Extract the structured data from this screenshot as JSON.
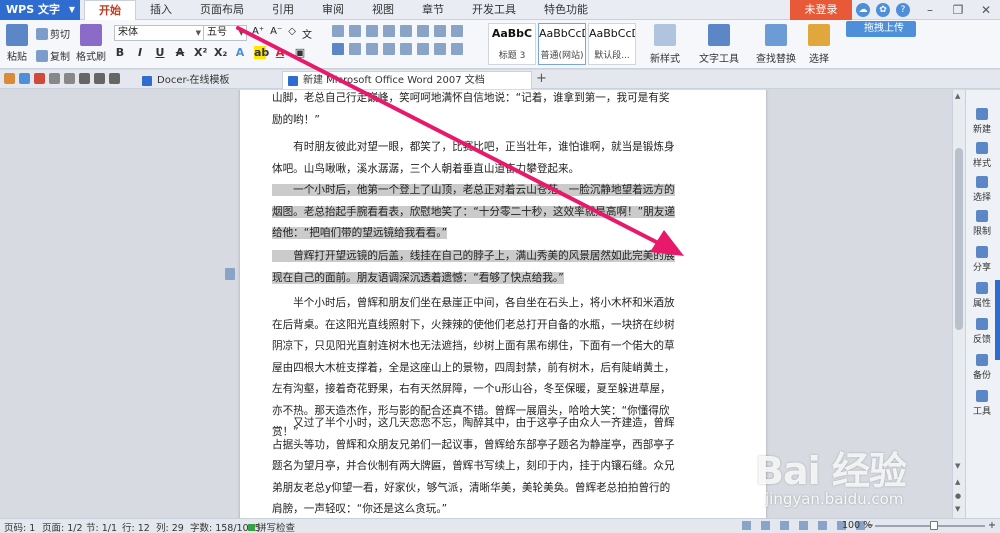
{
  "app": {
    "name": "WPS 文字",
    "accent": "#2e6ccf"
  },
  "menu": [
    "开始",
    "插入",
    "页面布局",
    "引用",
    "审阅",
    "视图",
    "章节",
    "开发工具",
    "特色功能"
  ],
  "login_label": "未登录",
  "upload_label": "拖拽上传",
  "clipboard": {
    "paste": "粘贴",
    "cut": "剪切",
    "copy": "复制",
    "format_painter": "格式刷"
  },
  "font": {
    "name": "宋体",
    "size": "五号"
  },
  "styles": [
    {
      "preview": "AaBbC",
      "name": "标题 3"
    },
    {
      "preview": "AaBbCcD",
      "name": "普通(网站)"
    },
    {
      "preview": "AaBbCcDd",
      "name": "默认段..."
    }
  ],
  "ribbon_buttons": {
    "new_style": "新样式",
    "text_tools": "文字工具",
    "find_replace": "查找替换",
    "select": "选择"
  },
  "doc_tabs": [
    {
      "label": "Docer-在线模板"
    },
    {
      "label": "新建 Microsoft Office Word 2007 文档 (2).docx *"
    }
  ],
  "document": {
    "paragraphs": [
      {
        "pre": "山脚，老总自己行走巅峰，笑呵呵地满怀自信地说：“记着，谁拿到第一，我可是有奖励的哟！”",
        "hl": "",
        "post": ""
      },
      {
        "pre": "　　有时朋友彼此对望一眼，都笑了，比赛比吧，正当壮年，谁怕谁啊，就当是锻炼身体吧。山鸟啾啾，溪水潺潺，三个人朝着垂直山道奋力攀登起来。",
        "hl": "",
        "post": ""
      },
      {
        "pre": "",
        "hl": "　　一个小时后，他第一个登上了山顶，老总正对着云山苍茫，一脸沉静地望着远方的烟图。老总抬起手腕看看表，欣慰地笑了：“十分零二十秒，这效率就是高啊！”朋友递给他：“把咱们带的望远镜给我看看。”",
        "post": ""
      },
      {
        "pre": "",
        "hl": "　　曾辉打开望远镜的后盖，线挂在自己的脖子上，满山秀美的风景居然如此完美的展现在自己的面前。朋友语调深沉透着遗憾：“看够了快点给我。”",
        "post": ""
      },
      {
        "pre": "　　半个小时后，曾辉和朋友们坐在悬崖正中间，各自坐在石头上，将小木杯和米酒放在后背桌。在这阳光直线照射下，火辣辣的使他们老总打开自备的水瓶，一块挤在纱树阴凉下，只见阳光直射连树木也无法遮挡，纱树上面有黑布绑住，下面有一个偌大的草屋由四根大木桩支撑着，全是这座山上的景物，四周封禁，前有树木，后有陡峭黄土，左有沟壑，接着奇花野果，右有天然屏障，一个u形山谷，冬至保暖，夏至躲进草屋，亦不热。那天造杰作，形与影的配合还真不错。曾辉一展眉头，哈哈大笑：“你懂得欣赏！”",
        "hl": "",
        "post": ""
      },
      {
        "pre": "　　又过了半个小时，这几天恋恋不忘，陶醉其中，由于这亭子由众人一齐建造，曾辉占据头等功，曾辉和众朋友兄弟们一起议事，曾辉给东部亭子题名为静崖亭，西部亭子题名为望月亭，并合伙制有两大牌匾，曾辉书写续上，刻印于内，挂于内镶石缝。众兄弟朋友老总y仰望一看，好家伙，够气派，清晰华美，美轮美奂。曾辉老总拍拍曾行的肩膀，一声轻叹：“你还是这么贪玩。”",
        "hl": "",
        "post": ""
      }
    ]
  },
  "side_panel": [
    "新建",
    "样式",
    "选择",
    "限制",
    "分享",
    "属性",
    "反馈",
    "备份",
    "工具"
  ],
  "status": {
    "page_num": "页码: 1",
    "pages": "页面: 1/2",
    "section": "节: 1/1",
    "row": "行: 12",
    "col": "列: 29",
    "words": "字数: 158/1065",
    "spell": "拼写检查",
    "zoom": "100 %"
  },
  "watermark": {
    "brand": "Bai 经验",
    "url": "jingyan.baidu.com"
  }
}
